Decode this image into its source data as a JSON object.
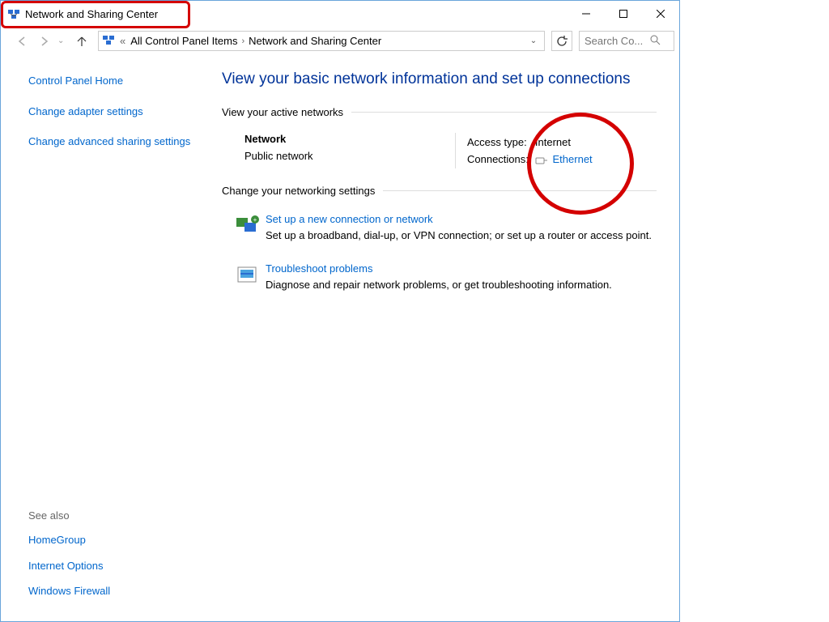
{
  "window": {
    "title": "Network and Sharing Center"
  },
  "address": {
    "seg1": "All Control Panel Items",
    "seg2": "Network and Sharing Center"
  },
  "search": {
    "placeholder": "Search Co..."
  },
  "sidebar": {
    "home": "Control Panel Home",
    "adapter": "Change adapter settings",
    "advanced": "Change advanced sharing settings",
    "see_also": "See also",
    "homegroup": "HomeGroup",
    "internet_options": "Internet Options",
    "firewall": "Windows Firewall"
  },
  "main": {
    "heading": "View your basic network information and set up connections",
    "active_networks_title": "View your active networks",
    "network_name": "Network",
    "network_type": "Public network",
    "access_label": "Access type:",
    "access_value": "Internet",
    "conn_label": "Connections:",
    "conn_value": "Ethernet",
    "change_settings_title": "Change your networking settings",
    "setup_title": "Set up a new connection or network",
    "setup_desc": "Set up a broadband, dial-up, or VPN connection; or set up a router or access point.",
    "trouble_title": "Troubleshoot problems",
    "trouble_desc": "Diagnose and repair network problems, or get troubleshooting information."
  }
}
